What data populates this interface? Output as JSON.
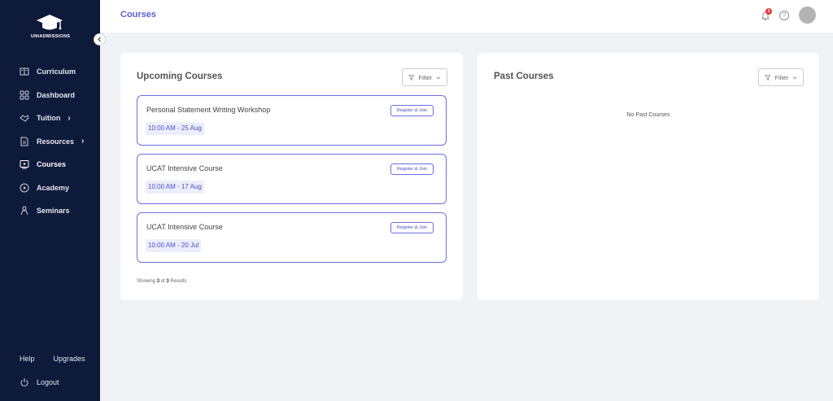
{
  "brand": {
    "name": "UNIADMISSIONS"
  },
  "sidebar": {
    "items": [
      {
        "label": "Curriculum",
        "icon": "book-icon",
        "chevron": false
      },
      {
        "label": "Dashboard",
        "icon": "grid-icon",
        "chevron": false
      },
      {
        "label": "Tuition",
        "icon": "handshake-icon",
        "chevron": true
      },
      {
        "label": "Resources",
        "icon": "document-icon",
        "chevron": true
      },
      {
        "label": "Courses",
        "icon": "play-screen-icon",
        "chevron": false,
        "active": true
      },
      {
        "label": "Academy",
        "icon": "play-circle-icon",
        "chevron": false
      },
      {
        "label": "Seminars",
        "icon": "presenter-icon",
        "chevron": false
      }
    ],
    "help_label": "Help",
    "upgrades_label": "Upgrades",
    "logout_label": "Logout"
  },
  "header": {
    "title": "Courses",
    "notification_count": "1",
    "help_glyph": "?"
  },
  "upcoming": {
    "title": "Upcoming Courses",
    "filter_label": "Filter",
    "courses": [
      {
        "name": "Personal Statement Writing Workshop",
        "button": "Register & Join",
        "date": "10:00 AM - 25 Aug"
      },
      {
        "name": "UCAT Intensive Course",
        "button": "Register & Join",
        "date": "10:00 AM - 17 Aug"
      },
      {
        "name": "UCAT Intensive Course",
        "button": "Register & Join",
        "date": "10:00 AM - 20 Jul"
      }
    ],
    "results": {
      "prefix": "Showing",
      "shown": "3",
      "of": "of",
      "total": "3",
      "suffix": "Results"
    }
  },
  "past": {
    "title": "Past Courses",
    "filter_label": "Filter",
    "empty_text": "No Past Courses"
  },
  "colors": {
    "sidebar_bg": "#0e1a3a",
    "accent": "#5a5fd6",
    "badge": "#e03a3a"
  }
}
